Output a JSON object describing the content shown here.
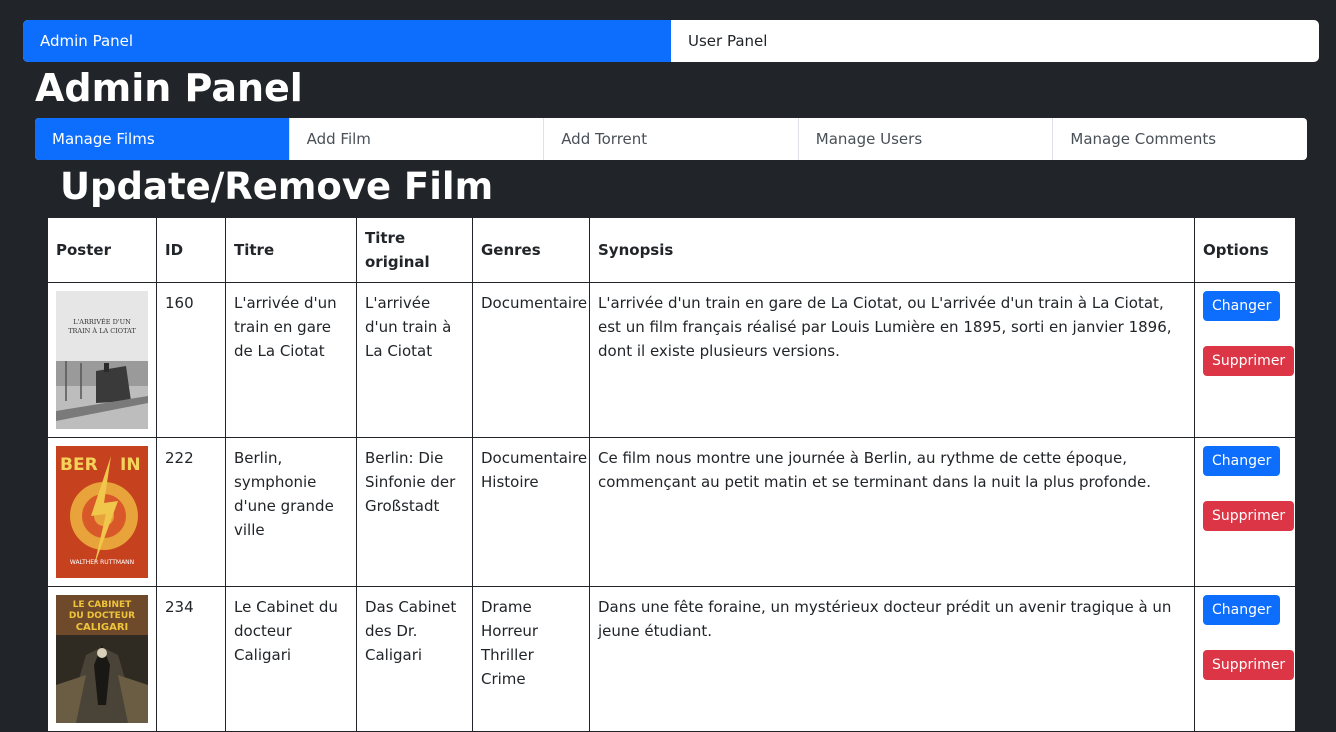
{
  "top_tabs": [
    {
      "label": "Admin Panel",
      "active": true
    },
    {
      "label": "User Panel",
      "active": false
    }
  ],
  "page_title": "Admin Panel",
  "sub_tabs": [
    {
      "label": "Manage Films",
      "active": true
    },
    {
      "label": "Add Film",
      "active": false
    },
    {
      "label": "Add Torrent",
      "active": false
    },
    {
      "label": "Manage Users",
      "active": false
    },
    {
      "label": "Manage Comments",
      "active": false
    }
  ],
  "section_title": "Update/Remove Film",
  "table": {
    "headers": [
      "Poster",
      "ID",
      "Titre",
      "Titre original",
      "Genres",
      "Synopsis",
      "Options"
    ],
    "rows": [
      {
        "id": "160",
        "titre": "L'arrivée d'un train en gare de La Ciotat",
        "titre_original": "L'arrivée d'un train à La Ciotat",
        "genres": "Documentaire",
        "synopsis": "L'arrivée d'un train en gare de La Ciotat, ou L'arrivée d'un train à La Ciotat, est un film français réalisé par Louis Lumière en 1895, sorti en janvier 1896, dont il existe plusieurs versions.",
        "poster_text": "L'ARRIVÉE D'UN TRAIN À LA CIOTAT"
      },
      {
        "id": "222",
        "titre": "Berlin, symphonie d'une grande ville",
        "titre_original": "Berlin: Die Sinfonie der Großstadt",
        "genres": "Documentaire Histoire",
        "synopsis": "Ce film nous montre une journée à Berlin, au rythme de cette époque, commençant au petit matin et se terminant dans la nuit la plus profonde.",
        "poster_text": "BERLIN"
      },
      {
        "id": "234",
        "titre": "Le Cabinet du docteur Caligari",
        "titre_original": "Das Cabinet des Dr. Caligari",
        "genres": "Drame Horreur Thriller Crime",
        "synopsis": "Dans une fête foraine, un mystérieux docteur prédit un avenir tragique à un jeune étudiant.",
        "poster_text": "LE CABINET DU DOCTEUR CALIGARI"
      }
    ],
    "change_label": "Changer",
    "delete_label": "Supprimer"
  },
  "colors": {
    "primary": "#0d6efd",
    "danger": "#dc3545",
    "background": "#212529"
  }
}
